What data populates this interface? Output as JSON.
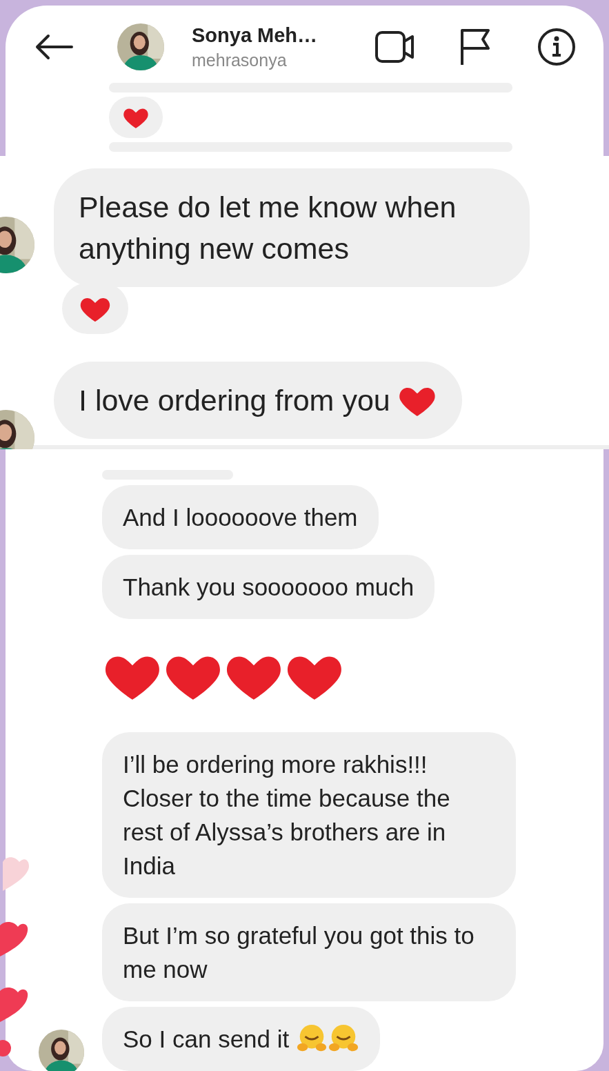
{
  "header": {
    "name": "Sonya Meh…",
    "username": "mehrasonya"
  },
  "top_panel": [
    {
      "kind": "clipped"
    },
    {
      "kind": "reaction",
      "emoji": {
        "kind": "heart"
      }
    },
    {
      "kind": "clipped"
    }
  ],
  "middle_panel": [
    {
      "kind": "text",
      "text": "Please do let me know when anything new comes",
      "avatar": true
    },
    {
      "kind": "reaction",
      "emoji": {
        "kind": "heart"
      }
    },
    {
      "kind": "text",
      "text": "I love ordering from you",
      "emojis": [
        {
          "kind": "heart"
        }
      ],
      "avatar": true
    }
  ],
  "bottom_panel": [
    {
      "kind": "clipped"
    },
    {
      "kind": "text",
      "text": "And I loooooove them"
    },
    {
      "kind": "text",
      "text": "Thank you sooooooo much"
    },
    {
      "kind": "big_emojis",
      "emojis": [
        {
          "kind": "heart"
        },
        {
          "kind": "heart"
        },
        {
          "kind": "heart"
        },
        {
          "kind": "heart"
        }
      ]
    },
    {
      "kind": "text",
      "text": "I’ll be ordering more rakhis!!! Closer to the time because the rest of Alyssa’s brothers are in India"
    },
    {
      "kind": "text",
      "text": "But I’m so grateful you got this to me now"
    },
    {
      "kind": "text",
      "text": "So I can send it",
      "emojis": [
        {
          "kind": "hug"
        },
        {
          "kind": "hug"
        }
      ],
      "avatar": true
    }
  ]
}
